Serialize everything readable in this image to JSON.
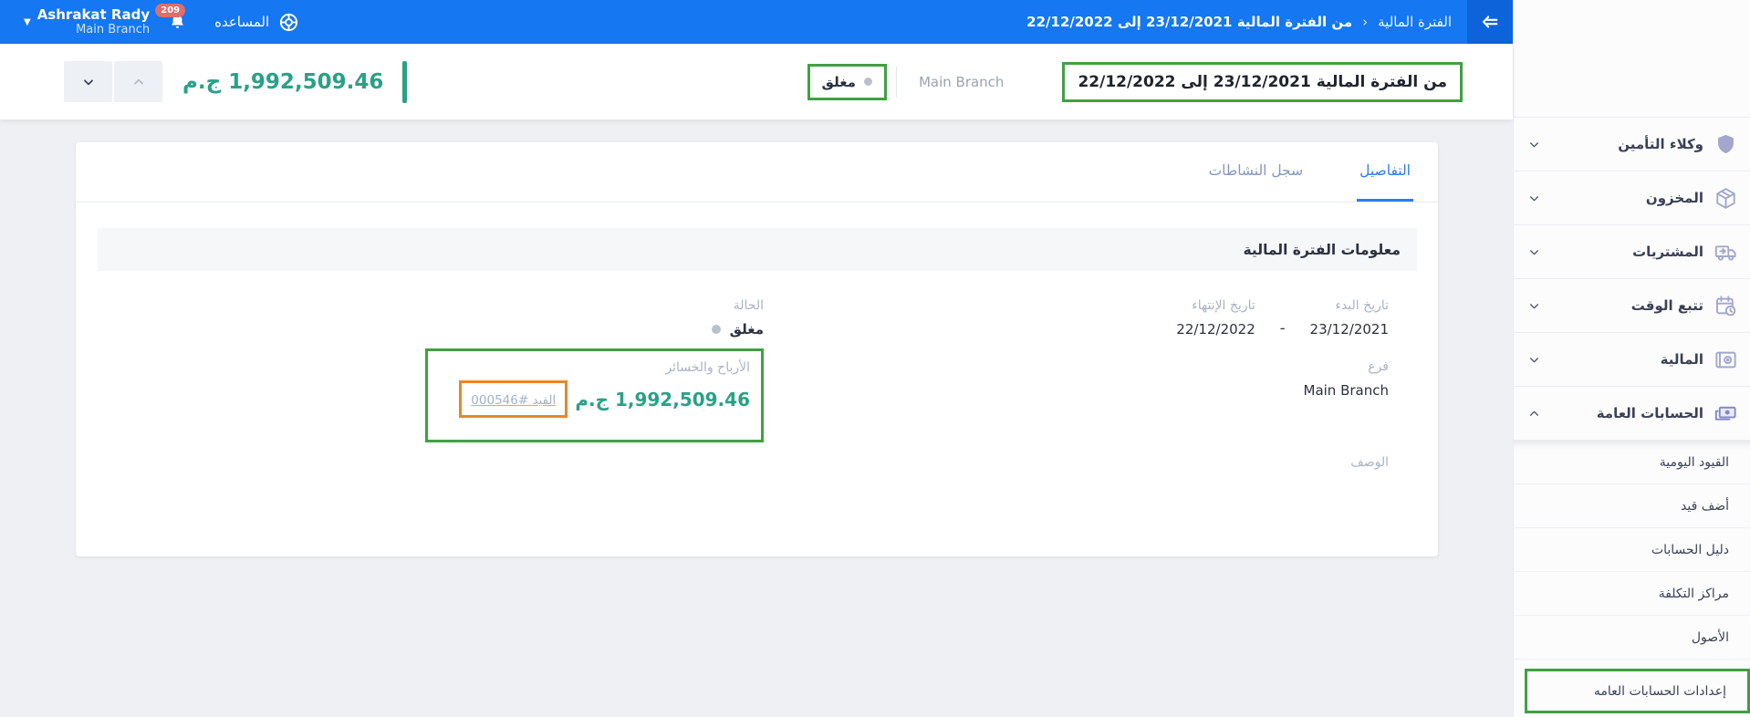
{
  "topbar": {
    "user": {
      "name": "Ashrakat Rady",
      "branch": "Main Branch",
      "notifications_count": "209"
    },
    "help_label": "المساعده",
    "breadcrumb": {
      "parent": "الفترة المالية",
      "chevron": "‹",
      "current": "من الفترة المالية 23/12/2021 إلى 22/12/2022"
    }
  },
  "subheader": {
    "title": "من الفترة المالية 23/12/2021 إلى 22/12/2022",
    "branch": "Main Branch",
    "status": "مغلق",
    "amount": "1,992,509.46 ج.م"
  },
  "sidebar": {
    "items": [
      {
        "label": "وكلاء التأمين",
        "icon": "shield-icon"
      },
      {
        "label": "المخزون",
        "icon": "package-icon"
      },
      {
        "label": "المشتريات",
        "icon": "truck-icon"
      },
      {
        "label": "تتبع الوقت",
        "icon": "calendar-clock-icon"
      },
      {
        "label": "المالية",
        "icon": "safe-icon"
      },
      {
        "label": "الحسابات العامة",
        "icon": "banknotes-icon",
        "expanded": true
      }
    ],
    "subitems": [
      {
        "label": "القيود اليومية"
      },
      {
        "label": "أضف قيد"
      },
      {
        "label": "دليل الحسابات"
      },
      {
        "label": "مراكز التكلفة"
      },
      {
        "label": "الأصول"
      },
      {
        "label": "إعدادات الحسابات العامه",
        "highlighted": true
      }
    ]
  },
  "card": {
    "tabs": [
      {
        "label": "التفاصيل",
        "active": true
      },
      {
        "label": "سجل النشاطات",
        "active": false
      }
    ],
    "section_title": "معلومات الفترة المالية",
    "fields": {
      "start_date_label": "تاريخ البدء",
      "start_date": "23/12/2021",
      "range_dash": "-",
      "end_date_label": "تاريخ الإنتهاء",
      "end_date": "22/12/2022",
      "status_label": "الحالة",
      "status": "مغلق",
      "branch_label": "فرع",
      "branch": "Main Branch",
      "pnl_label": "الأرباح والخسائر",
      "pnl_amount": "1,992,509.46 ج.م",
      "pnl_entry_link": "القيد #000546",
      "description_label": "الوصف"
    }
  },
  "colors": {
    "topbar_blue": "#1577f2",
    "collapse_btn_blue": "#0d64da",
    "accent_teal": "#2aa187",
    "annotation_green": "#3fa142",
    "annotation_orange": "#e8872b",
    "active_tab_blue": "#2e7cf6",
    "notification_red": "#e06c6c",
    "status_dot_gray": "#b9c0cc"
  }
}
